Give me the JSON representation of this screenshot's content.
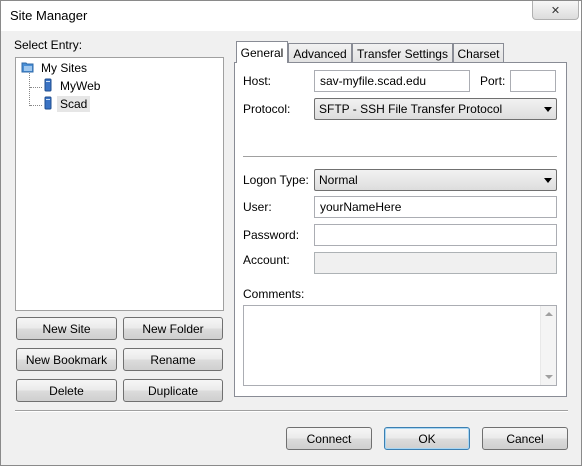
{
  "window": {
    "title": "Site Manager",
    "close_icon": "close-icon"
  },
  "tree": {
    "label": "Select Entry:",
    "root": {
      "label": "My Sites",
      "icon": "folder-icon"
    },
    "items": [
      {
        "label": "MyWeb",
        "icon": "server-icon",
        "selected": false
      },
      {
        "label": "Scad",
        "icon": "server-icon",
        "selected": true
      }
    ]
  },
  "left_buttons": {
    "new_site": "New Site",
    "new_folder": "New Folder",
    "new_bookmark": "New Bookmark",
    "rename": "Rename",
    "delete": "Delete",
    "duplicate": "Duplicate"
  },
  "tabs": [
    {
      "label": "General",
      "active": true
    },
    {
      "label": "Advanced",
      "active": false
    },
    {
      "label": "Transfer Settings",
      "active": false
    },
    {
      "label": "Charset",
      "active": false
    }
  ],
  "general": {
    "host_label": "Host:",
    "host_value": "sav-myfile.scad.edu",
    "port_label": "Port:",
    "port_value": "",
    "protocol_label": "Protocol:",
    "protocol_value": "SFTP - SSH File Transfer Protocol",
    "logon_type_label": "Logon Type:",
    "logon_type_value": "Normal",
    "user_label": "User:",
    "user_value": "yourNameHere",
    "password_label": "Password:",
    "password_value": "",
    "account_label": "Account:",
    "account_value": "",
    "comments_label": "Comments:",
    "comments_value": ""
  },
  "footer_buttons": {
    "connect": "Connect",
    "ok": "OK",
    "cancel": "Cancel"
  }
}
